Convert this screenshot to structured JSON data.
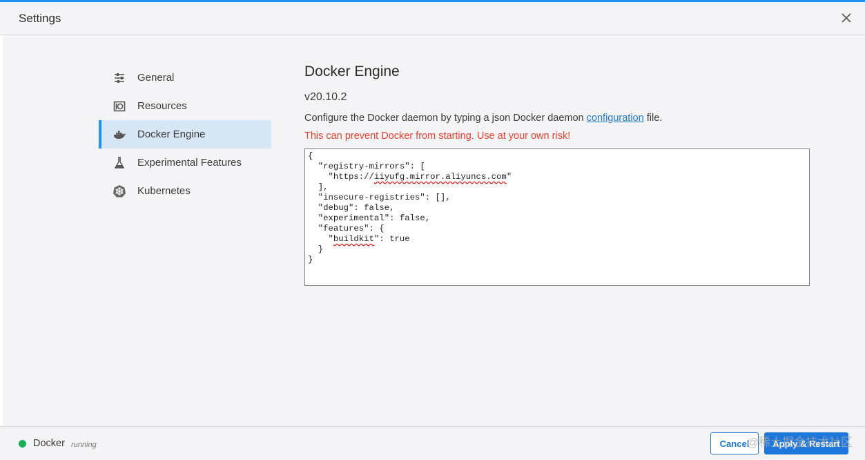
{
  "window": {
    "title": "Settings",
    "accent_color": "#1e90ff"
  },
  "sidebar": {
    "items": [
      {
        "label": "General",
        "icon": "sliders-icon",
        "active": false
      },
      {
        "label": "Resources",
        "icon": "resources-icon",
        "active": false
      },
      {
        "label": "Docker Engine",
        "icon": "whale-icon",
        "active": true
      },
      {
        "label": "Experimental Features",
        "icon": "flask-icon",
        "active": false
      },
      {
        "label": "Kubernetes",
        "icon": "helm-icon",
        "active": false
      }
    ]
  },
  "main": {
    "title": "Docker Engine",
    "version": "v20.10.2",
    "description_prefix": "Configure the Docker daemon by typing a json Docker daemon ",
    "description_link": "configuration",
    "description_suffix": " file.",
    "warning": "This can prevent Docker from starting. Use at your own risk!",
    "warning_color": "#e8412e",
    "config_lines": [
      "{",
      "  \"registry-mirrors\": [",
      "    \"https://iiyufg.mirror.aliyuncs.com\"",
      "  ],",
      "  \"insecure-registries\": [],",
      "  \"debug\": false,",
      "  \"experimental\": false,",
      "  \"features\": {",
      "    \"buildkit\": true",
      "  }",
      "}"
    ]
  },
  "footer": {
    "status_name": "Docker",
    "status_state": "running",
    "status_color": "#1aae5a",
    "cancel_label": "Cancel",
    "apply_label": "Apply & Restart",
    "watermark": "@稀土掘金技术社区"
  }
}
